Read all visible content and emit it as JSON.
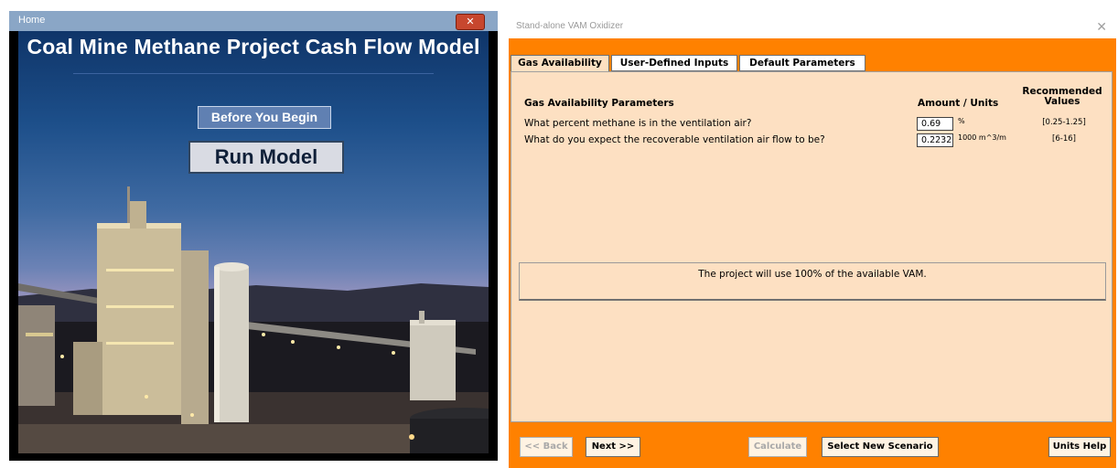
{
  "home_window": {
    "title": "Home",
    "close_glyph": "✕",
    "heading": "Coal Mine Methane Project Cash Flow Model",
    "before_you_begin_label": "Before You Begin",
    "run_model_label": "Run Model"
  },
  "vam_window": {
    "title": "Stand-alone VAM Oxidizer",
    "close_glyph": "✕",
    "tabs": [
      {
        "label": "Gas Availability",
        "selected": true
      },
      {
        "label": "User-Defined Inputs",
        "selected": false
      },
      {
        "label": "Default Parameters",
        "selected": false
      }
    ],
    "panel": {
      "section_heading": "Gas Availability Parameters",
      "amount_header": "Amount / Units",
      "recommended_header": "Recommended Values",
      "rows": [
        {
          "question": "What percent methane is in the ventilation air?",
          "value": "0.69",
          "unit": "%",
          "recommended": "[0.25-1.25]"
        },
        {
          "question": "What do you expect the recoverable ventilation air flow to be?",
          "value": "0.2232",
          "unit": "1000 m^3/m",
          "recommended": "[6-16]"
        }
      ],
      "info_message": "The project will use 100% of the available VAM."
    },
    "buttons": {
      "back": "<< Back",
      "next": "Next >>",
      "calculate": "Calculate",
      "select_new_scenario": "Select New Scenario",
      "units_help": "Units Help"
    }
  },
  "colors": {
    "orange_frame": "#ff8100",
    "panel_peach": "#fde0c2",
    "home_titlebar": "#8aa6c6",
    "close_red": "#c7472e"
  }
}
